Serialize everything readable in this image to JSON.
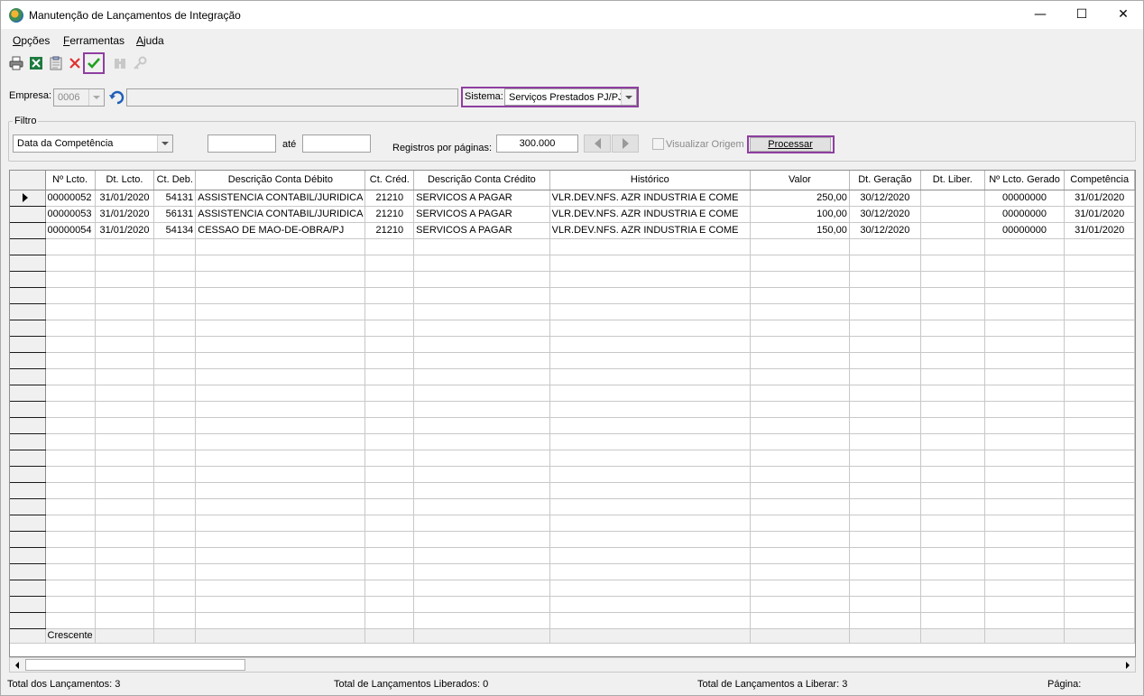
{
  "window": {
    "title": "Manutenção de Lançamentos de Integração",
    "minimize": "—",
    "maximize": "☐",
    "close": "✕"
  },
  "menu": [
    "Opções",
    "Ferramentas",
    "Ajuda"
  ],
  "toolbar": {
    "icons": [
      "print-icon",
      "excel-export-icon",
      "clipboard-icon",
      "delete-icon",
      "confirm-icon",
      "binoculars-icon",
      "key-icon"
    ],
    "colors": {
      "delete": "#e03030",
      "confirm": "#20a020",
      "highlight": "#8e3ea0"
    }
  },
  "empresa": {
    "label": "Empresa:",
    "code": "0006",
    "name": ""
  },
  "sistema": {
    "label": "Sistema:",
    "value": "Serviços Prestados PJ/PJ"
  },
  "filtro": {
    "title": "Filtro",
    "type": "Data da Competência",
    "from": "",
    "to_label": "até",
    "to": "",
    "per_page_label": "Registros por páginas:",
    "per_page": "300.000",
    "visualizar_origem": "Visualizar Origem",
    "visualizar_origem_checked": false,
    "processar": "Processar"
  },
  "grid": {
    "columns": [
      "Nº Lcto.",
      "Dt. Lcto.",
      "Ct. Deb.",
      "Descrição Conta Débito",
      "Ct. Créd.",
      "Descrição Conta Crédito",
      "Histórico",
      "Valor",
      "Dt. Geração",
      "Dt. Liber.",
      "Nº Lcto. Gerado",
      "Competência"
    ],
    "rows": [
      [
        "00000052",
        "31/01/2020",
        "54131",
        "ASSISTENCIA CONTABIL/JURIDICA",
        "21210",
        "SERVICOS A PAGAR",
        "VLR.DEV.NFS. AZR INDUSTRIA E COME",
        "250,00",
        "30/12/2020",
        "",
        "00000000",
        "31/01/2020"
      ],
      [
        "00000053",
        "31/01/2020",
        "56131",
        "ASSISTENCIA CONTABIL/JURIDICA",
        "21210",
        "SERVICOS A PAGAR",
        "VLR.DEV.NFS. AZR INDUSTRIA E COME",
        "100,00",
        "30/12/2020",
        "",
        "00000000",
        "31/01/2020"
      ],
      [
        "00000054",
        "31/01/2020",
        "54134",
        "CESSAO DE MAO-DE-OBRA/PJ",
        "21210",
        "SERVICOS A PAGAR",
        "VLR.DEV.NFS. AZR INDUSTRIA E COME",
        "150,00",
        "30/12/2020",
        "",
        "00000000",
        "31/01/2020"
      ]
    ],
    "footer": "Crescente"
  },
  "status": {
    "total": "Total dos Lançamentos: 3",
    "liberados": "Total de Lançamentos Liberados: 0",
    "a_liberar": "Total de Lançamentos a Liberar: 3",
    "pagina": "Página:"
  }
}
